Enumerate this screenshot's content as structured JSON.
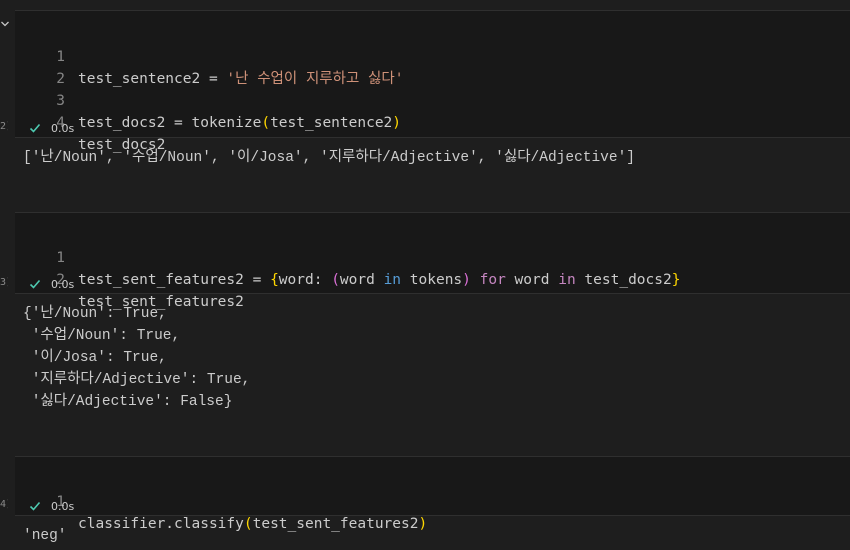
{
  "cells": [
    {
      "exec_count": "2]",
      "status_time": "0.0s",
      "code_lines": [
        {
          "num": "1",
          "tokens": [
            {
              "t": "test_sentence2 = ",
              "c": "t-var"
            },
            {
              "t": "'난 수업이 지루하고 싫다'",
              "c": "t-str"
            }
          ]
        },
        {
          "num": "2",
          "tokens": []
        },
        {
          "num": "3",
          "tokens": [
            {
              "t": "test_docs2 = tokenize",
              "c": "t-var"
            },
            {
              "t": "(",
              "c": "t-br1"
            },
            {
              "t": "test_sentence2",
              "c": "t-var"
            },
            {
              "t": ")",
              "c": "t-br1"
            }
          ]
        },
        {
          "num": "4",
          "tokens": [
            {
              "t": "test_docs2",
              "c": "t-var"
            }
          ]
        }
      ],
      "output_lines": [
        "['난/Noun', '수업/Noun', '이/Josa', '지루하다/Adjective', '싫다/Adjective']"
      ]
    },
    {
      "exec_count": "3]",
      "status_time": "0.0s",
      "code_lines": [
        {
          "num": "1",
          "tokens": [
            {
              "t": "test_sent_features2 = ",
              "c": "t-var"
            },
            {
              "t": "{",
              "c": "t-br1"
            },
            {
              "t": "word: ",
              "c": "t-var"
            },
            {
              "t": "(",
              "c": "t-br2"
            },
            {
              "t": "word ",
              "c": "t-var"
            },
            {
              "t": "in",
              "c": "t-kw"
            },
            {
              "t": " tokens",
              "c": "t-var"
            },
            {
              "t": ")",
              "c": "t-br2"
            },
            {
              "t": " ",
              "c": "t-var"
            },
            {
              "t": "for",
              "c": "t-ctl"
            },
            {
              "t": " word ",
              "c": "t-var"
            },
            {
              "t": "in",
              "c": "t-ctl"
            },
            {
              "t": " test_docs2",
              "c": "t-var"
            },
            {
              "t": "}",
              "c": "t-br1"
            }
          ]
        },
        {
          "num": "2",
          "tokens": [
            {
              "t": "test_sent_features2",
              "c": "t-var"
            }
          ]
        }
      ],
      "output_lines": [
        "{'난/Noun': True,",
        " '수업/Noun': True,",
        " '이/Josa': True,",
        " '지루하다/Adjective': True,",
        " '싫다/Adjective': False}"
      ]
    },
    {
      "exec_count": "4]",
      "status_time": "0.0s",
      "code_lines": [
        {
          "num": "1",
          "tokens": [
            {
              "t": "classifier.classify",
              "c": "t-var"
            },
            {
              "t": "(",
              "c": "t-br1"
            },
            {
              "t": "test_sent_features2",
              "c": "t-var"
            },
            {
              "t": ")",
              "c": "t-br1"
            }
          ]
        }
      ],
      "output_lines": [
        "'neg'"
      ]
    }
  ],
  "icons": {
    "collapse": "chevron-down-icon",
    "status": "check-icon"
  },
  "colors": {
    "success_check": "#4ec9b0"
  }
}
